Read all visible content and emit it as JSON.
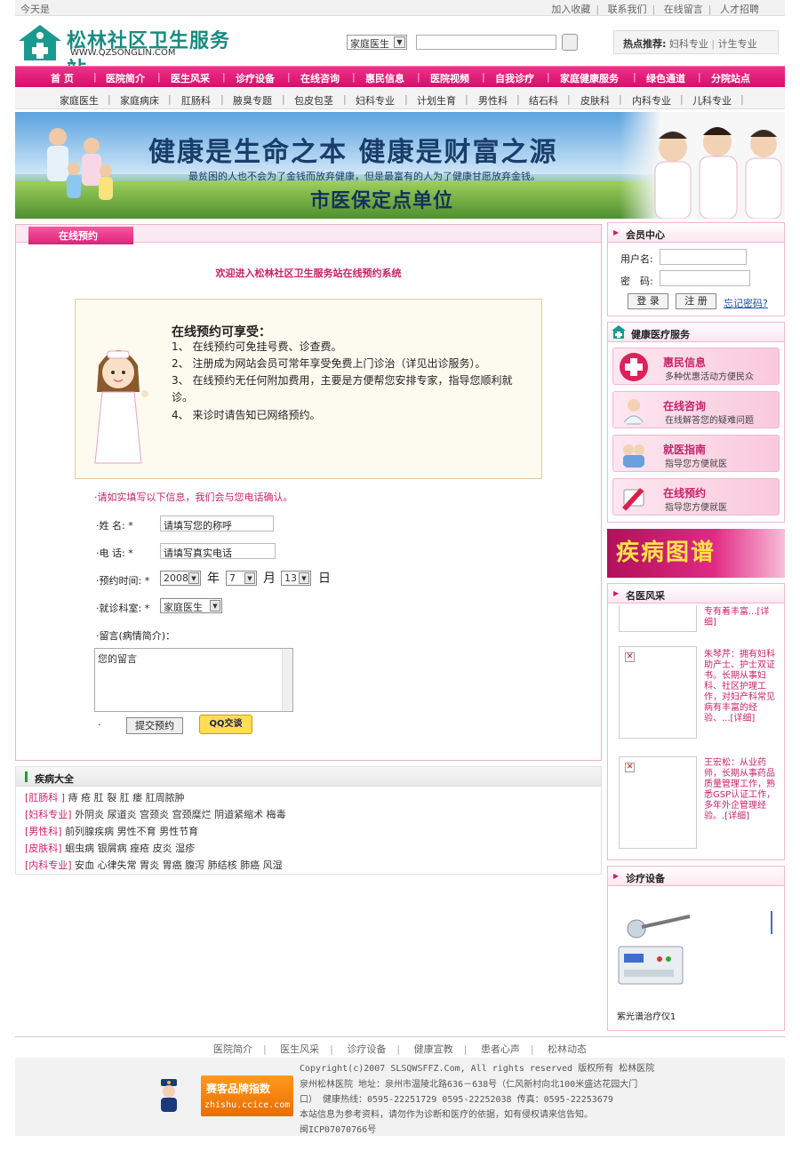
{
  "topbar": {
    "today": "今天是",
    "links": [
      "加入收藏",
      "联系我们",
      "在线留言",
      "人才招聘"
    ]
  },
  "logo": {
    "name": "松林社区卫生服务站",
    "url": "WWW.QZSONGLIN.COM"
  },
  "search": {
    "selected": "家庭医生",
    "placeholder": ""
  },
  "hot": {
    "label": "热点推荐:",
    "items": [
      "妇科专业",
      "计生专业"
    ]
  },
  "nav_main": [
    "首 页",
    "医院简介",
    "医生风采",
    "诊疗设备",
    "在线咨询",
    "惠民信息",
    "医院视频",
    "自我诊疗",
    "家庭健康服务",
    "绿色通道",
    "分院站点"
  ],
  "nav_sub": [
    "家庭医生",
    "家庭病床",
    "肛肠科",
    "腋臭专题",
    "包皮包茎",
    "妇科专业",
    "计划生育",
    "男性科",
    "结石科",
    "皮肤科",
    "内科专业",
    "儿科专业"
  ],
  "banner": {
    "line1": "健康是生命之本 健康是财富之源",
    "line2": "最贫困的人也不会为了金钱而放弃健康，但是最富有的人为了健康甘愿放弃金钱。",
    "line3": "市医保定点单位"
  },
  "main": {
    "tab": "在线预约",
    "welcome": "欢迎进入松林社区卫生服务站在线预约系统",
    "box_title": "在线预约可享受：",
    "benefits": [
      "1、  在线预约可免挂号费、诊查费。",
      "2、  注册成为网站会员可常年享受免费上门诊治（详见出诊服务）。",
      "3、  在线预约无任何附加费用，主要是方便帮您安排专家，指导您顺利就诊。",
      "4、  来诊时请告知已网络预约。"
    ],
    "notice": "·请如实填写以下信息，我们会与您电话确认。",
    "form": {
      "name_label": "·姓    名: *",
      "name_value": "请填写您的称呼",
      "phone_label": "·电    话: *",
      "phone_value": "请填写真实电话",
      "time_label": "·预约时间: *",
      "year": "2008",
      "year_unit": "年",
      "month": "7",
      "month_unit": "月",
      "day": "13",
      "day_unit": "日",
      "dept_label": "·就诊科室: *",
      "dept": "家庭医生",
      "msg_label": "·留言(病情简介)：",
      "msg_value": "您的留言",
      "dot": "·",
      "submit": "提交预约",
      "qq": "QQ交谈"
    }
  },
  "diseases": {
    "title": "疾病大全",
    "rows": [
      {
        "cat": "[肛肠科 ]",
        "items": "痔 疮 肛 裂 肛 瘘 肛周脓肿"
      },
      {
        "cat": "[妇科专业]",
        "items": "外阴炎 尿道炎 宫颈炎 宫颈糜烂 阴道紧缩术 梅毒"
      },
      {
        "cat": "[男性科]",
        "items": "前列腺疾病 男性不育 男性节育"
      },
      {
        "cat": "[皮肤科]",
        "items": "蛔虫病 银屑病 痤疮 皮炎 湿疹"
      },
      {
        "cat": "[内科专业]",
        "items": "安血 心律失常 胃炎 胃癌 腹泻 肺结核 肺癌 风湿"
      }
    ]
  },
  "member": {
    "title": "会员中心",
    "user_label": "用户名:",
    "pwd_label": "密　码:",
    "login": "登 录",
    "register": "注 册",
    "forgot": "忘记密码?"
  },
  "services": {
    "title": "健康医疗服务",
    "items": [
      {
        "title": "惠民信息",
        "sub": "多种优惠活动方便民众",
        "icon": "cross-icon"
      },
      {
        "title": "在线咨询",
        "sub": "在线解答您的疑难问题",
        "icon": "doctor-icon"
      },
      {
        "title": "就医指南",
        "sub": "指导您方便就医",
        "icon": "guide-icon"
      },
      {
        "title": "在线预约",
        "sub": "指导您方便就医",
        "icon": "pen-icon"
      }
    ]
  },
  "disease_atlas": "疾病图谱",
  "doctors": {
    "title": "名医风采",
    "top": "专有着丰富...[详细]",
    "items": [
      {
        "text": "朱琴芹：拥有妇科助产士、护士双证书。长期从事妇科、社区护理工作，对妇产科常见病有丰富的经验、...[详细]"
      },
      {
        "text": "王宏松：从业药师，长期从事药品质量管理工作，熟悉GSP认证工作，多年外企管理经验。.[详细]"
      }
    ]
  },
  "equipment": {
    "title": "诊疗设备",
    "caption": "紫光谱治疗仪1"
  },
  "footer": {
    "links": [
      "医院简介",
      "医生风采",
      "诊疗设备",
      "健康宣教",
      "患者心声",
      "松林动态"
    ],
    "lines": [
      "Copyright(c)2007 SLSQWSFFZ.Com, All rights reserved 版权所有 松林医院",
      "泉州松林医院 地址：泉州市温陵北路636－638号（仁风新村向北100米盛达花园大门",
      "口） 健康热线：0595-22251729 0595-22252038 传真：0595-22253679",
      "本站信息为参考资料，请勿作为诊断和医疗的依据，如有侵权请来信告知。",
      "闽ICP07070766号"
    ],
    "badge_line1": "赛客品牌指数",
    "badge_line2": "zhishu.ccice.com"
  }
}
